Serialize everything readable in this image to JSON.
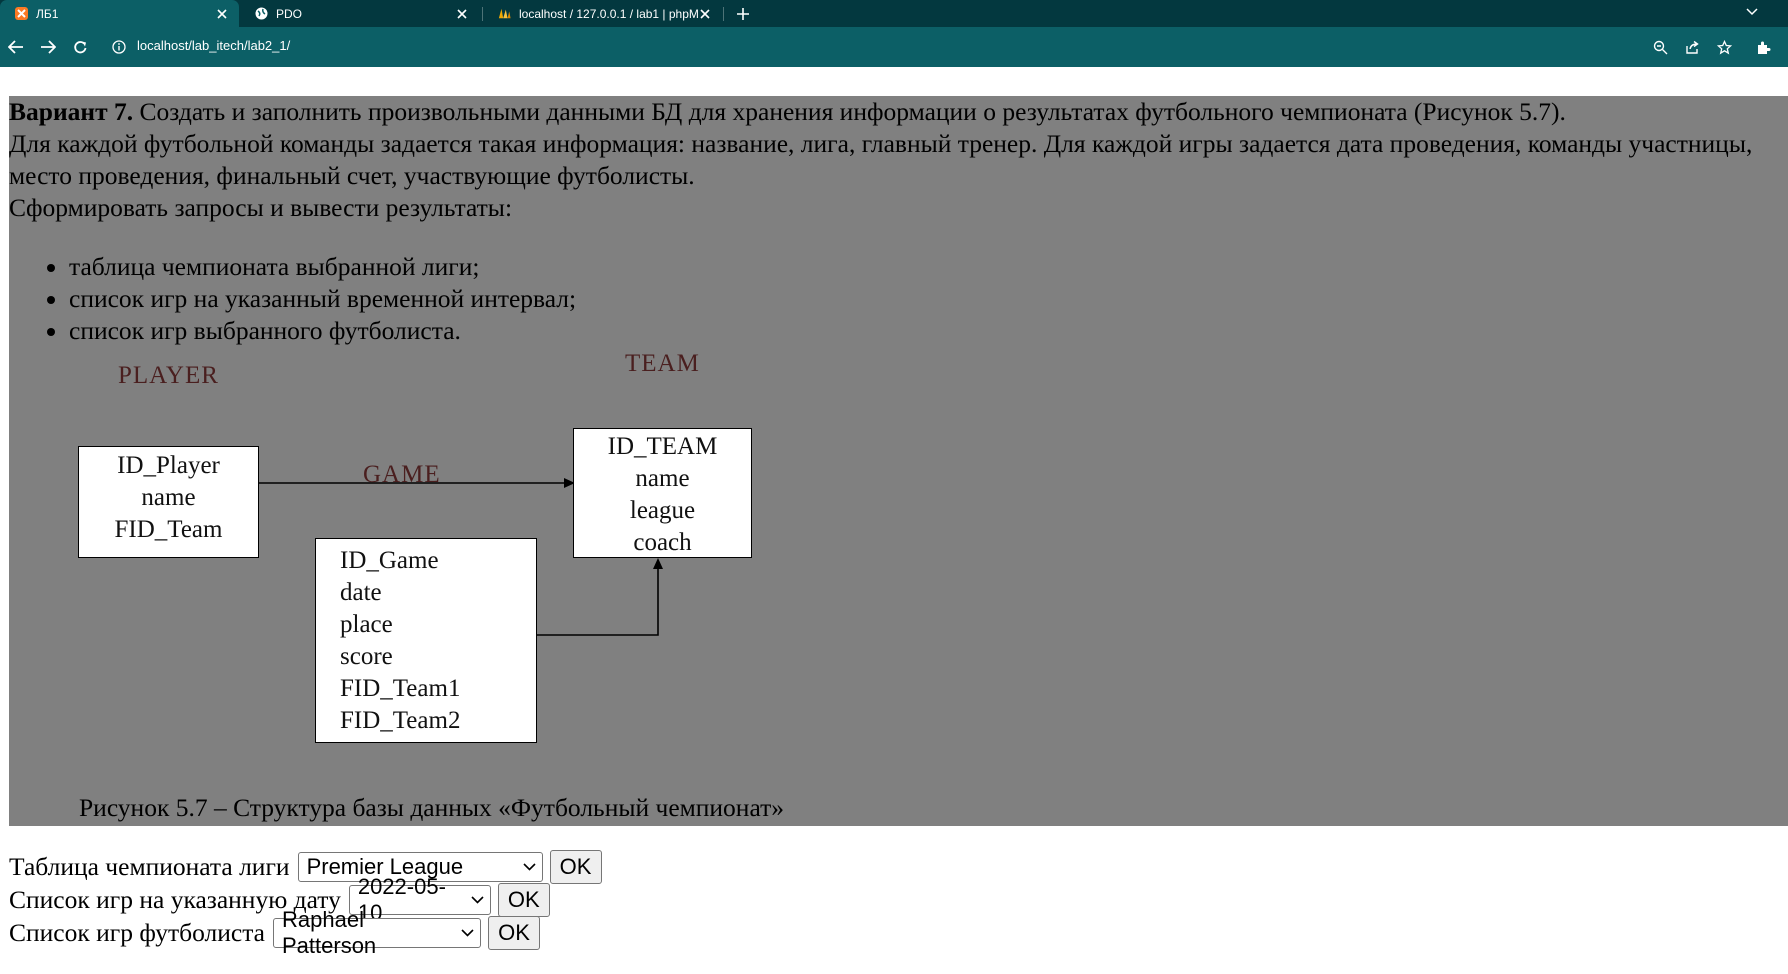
{
  "browser": {
    "tabs": [
      {
        "title": "ЛБ1",
        "favicon": "xampp-icon",
        "active": true
      },
      {
        "title": "PDO",
        "favicon": "globe-icon",
        "active": false
      },
      {
        "title": "localhost / 127.0.0.1 / lab1 | phpM",
        "favicon": "phpmyadmin-icon",
        "active": false
      }
    ],
    "url": "localhost/lab_itech/lab2_1/"
  },
  "task": {
    "variant_label": "Вариант 7.",
    "intro_text": " Создать и заполнить произвольными данными БД для хранения информации о результатах футбольного чемпионата (Рисунок 5.7).",
    "description": "Для каждой футбольной команды задается такая информация: название, лига, главный тренер. Для каждой игры задается дата проведения, команды участницы, место проведения, финальный счет, участвующие футболисты.",
    "request_intro": "Сформировать запросы и вывести результаты:",
    "requirements": [
      "таблица чемпионата выбранной лиги;",
      "список игр на указанный временной интервал;",
      "список игр выбранного футболиста."
    ]
  },
  "diagram": {
    "player": {
      "title": "PLAYER",
      "fields": [
        "ID_Player",
        "name",
        "FID_Team"
      ]
    },
    "team": {
      "title": "TEAM",
      "fields": [
        "ID_TEAM",
        "name",
        "league",
        "coach"
      ]
    },
    "game": {
      "title": "GAME",
      "fields": [
        "ID_Game",
        "date",
        "place",
        "score",
        "FID_Team1",
        "FID_Team2"
      ]
    },
    "caption": "Рисунок 5.7 – Структура базы данных «Футбольный чемпионат»"
  },
  "forms": {
    "league": {
      "label": "Таблица чемпионата лиги",
      "selected": "Premier League",
      "button": "OK"
    },
    "date": {
      "label": "Список игр на указанную дату",
      "selected": "2022-05-10",
      "button": "OK"
    },
    "player": {
      "label": "Список игр футболиста",
      "selected": "Raphael Patterson",
      "button": "OK"
    }
  }
}
